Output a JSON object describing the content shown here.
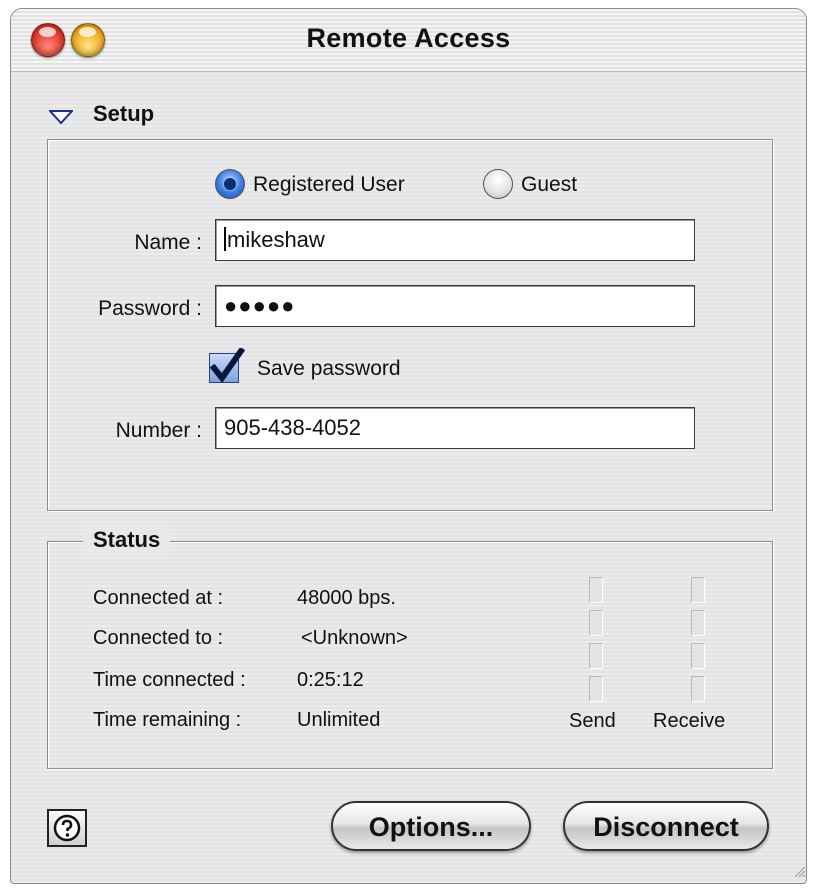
{
  "window": {
    "title": "Remote Access"
  },
  "setup": {
    "section_label": "Setup",
    "user_type": {
      "registered_label": "Registered User",
      "guest_label": "Guest",
      "selected": "Registered User"
    },
    "name": {
      "label": "Name :",
      "value": "mikeshaw"
    },
    "password": {
      "label": "Password :",
      "value": "●●●●●"
    },
    "save_password": {
      "label": "Save password",
      "checked": true
    },
    "number": {
      "label": "Number :",
      "value": "905-438-4052"
    }
  },
  "status": {
    "section_label": "Status",
    "rows": [
      {
        "label": "Connected at :",
        "value": "48000 bps."
      },
      {
        "label": "Connected to :",
        "value": "<Unknown>"
      },
      {
        "label": "Time connected :",
        "value": "0:25:12"
      },
      {
        "label": "Time remaining :",
        "value": "Unlimited"
      }
    ],
    "send_label": "Send",
    "receive_label": "Receive"
  },
  "buttons": {
    "help_icon": "help-icon",
    "options_label": "Options...",
    "disconnect_label": "Disconnect"
  },
  "colors": {
    "radio_selected": "#3b7ae0",
    "checkbox_fill": "#7ba2e0",
    "window_bg": "#e8e8e8"
  }
}
